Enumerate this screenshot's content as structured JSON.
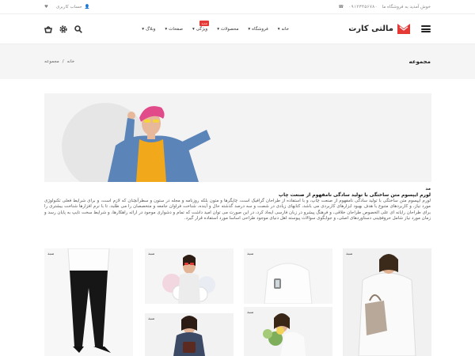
{
  "topbar": {
    "welcome": "خوش آمدید به فروشگاه ما",
    "phone": "۰۹۱۲۳۴۵۶۷۸۰",
    "account": "حساب کاربری"
  },
  "header": {
    "logo": "مالتی کارت",
    "nav": [
      {
        "label": "خانه",
        "badge": ""
      },
      {
        "label": "فروشگاه",
        "badge": ""
      },
      {
        "label": "محصولات",
        "badge": ""
      },
      {
        "label": "ویژگی",
        "badge": "جدید"
      },
      {
        "label": "صفحات",
        "badge": ""
      },
      {
        "label": "وبلاگ",
        "badge": ""
      }
    ]
  },
  "page": {
    "title": "مجموعه",
    "breadcrumb": {
      "home": "خانه",
      "sep": "/",
      "current": "مجموعه"
    }
  },
  "category": {
    "tag": "مد",
    "heading": "لورم ایپسوم متن ساختگی با تولید سادگی نامفهوم از صنعت چاپ",
    "description": "لورم ایپسوم متن ساختگی با تولید سادگی نامفهوم از صنعت چاپ، و با استفاده از طراحان گرافیک است، چاپگرها و متون بلکه روزنامه و مجله در ستون و سطرآنچنان که لازم است، و برای شرایط فعلی تکنولوژی مورد نیاز، و کاربردهای متنوع با هدف بهبود ابزارهای کاربردی می باشد، کتابهای زیادی در شصت و سه درصد گذشته حال و آینده، شناخت فراوان جامعه و متخصصان را می طلبد، تا با نرم افزارها شناخت بیشتری را برای طراحان رایانه ای علی الخصوص طراحان خلاقی، و فرهنگ پیشرو در زبان فارسی ایجاد کرد، در این صورت می توان امید داشت که تمام و دشواری موجود در ارائه راهکارها، و شرایط سخت تایپ به پایان رسد و زمان مورد نیاز شامل حروفچینی دستاوردهای اصلی، و جوابگوی سوالات پیوسته اهل دنیای موجود طراحی اساسا مورد استفاده قرار گیرد."
  },
  "products": [
    "سبد",
    "سبد",
    "سبد",
    "سبد",
    "سبد",
    "سبد"
  ]
}
